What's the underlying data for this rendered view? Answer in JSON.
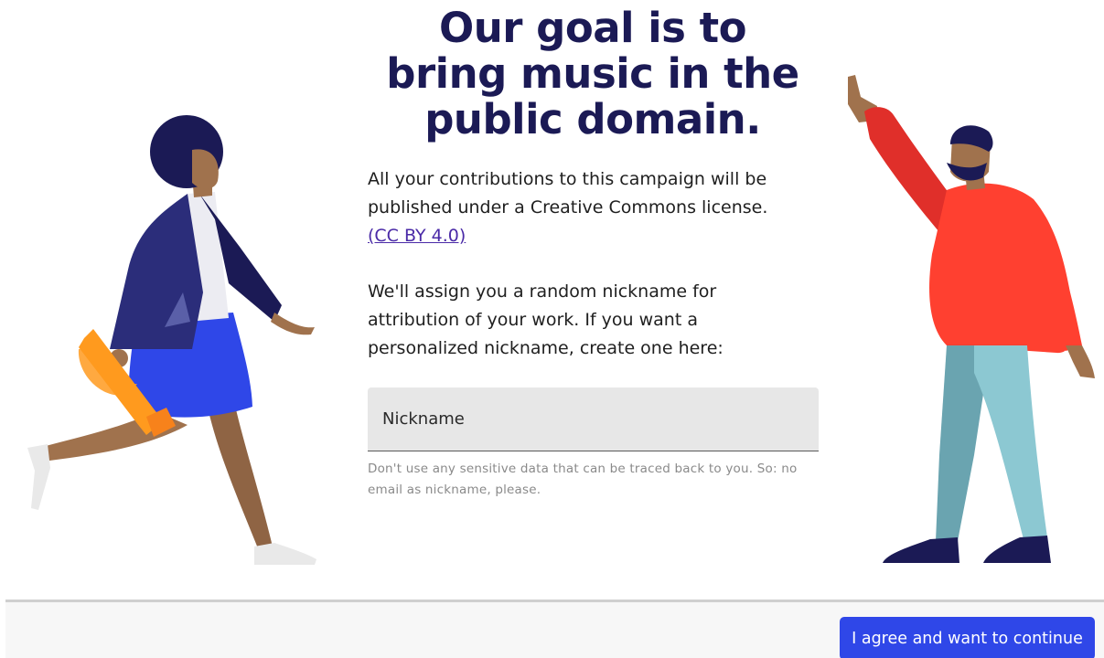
{
  "headline": {
    "line1": "Our goal is to",
    "line2": "bring music in the",
    "line3": "public domain."
  },
  "intro": {
    "text": "All your contributions to this campaign will be published under a Creative Commons license.",
    "license_link": "(CC BY 4.0)"
  },
  "nickname": {
    "text": "We'll assign you a random nickname for attribution of your work. If you want a personalized nickname, create one here:",
    "placeholder": "Nickname",
    "value": "",
    "helper": "Don't use any sensitive data that can be traced back to you. So: no email as nickname, please."
  },
  "footer": {
    "continue_label": "I agree and want to continue"
  },
  "colors": {
    "headline": "#1b1a55",
    "link": "#4a2aa7",
    "button": "#2f47e8",
    "field_bg": "#e7e7e7",
    "helper_text": "#8a8a8a"
  },
  "illustrations": {
    "left": "woman-with-trumpet-illustration",
    "right": "man-waving-illustration"
  }
}
